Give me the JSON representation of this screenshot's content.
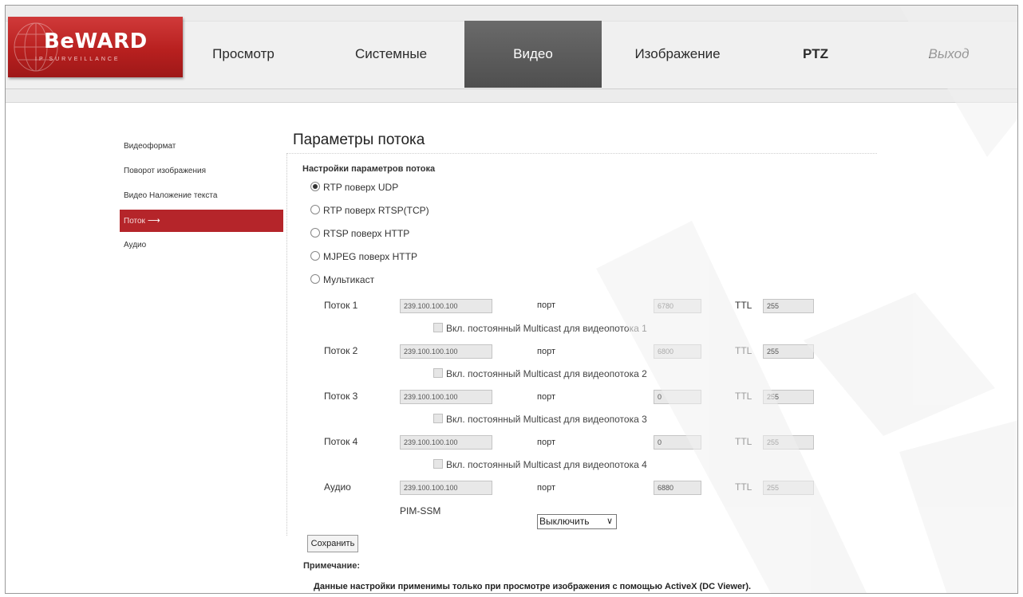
{
  "brand": {
    "logo_text": "BeWARD",
    "tagline": "IP SURVEILLANCE"
  },
  "nav": {
    "tabs": [
      {
        "label": "Просмотр"
      },
      {
        "label": "Системные"
      },
      {
        "label": "Видео",
        "active": true
      },
      {
        "label": "Изображение"
      },
      {
        "label": "PTZ"
      },
      {
        "label": "Выход"
      }
    ]
  },
  "sidebar": {
    "items": [
      {
        "label": "Видеоформат"
      },
      {
        "label": "Поворот изображения"
      },
      {
        "label": "Видео Наложение текста"
      },
      {
        "label": "Поток",
        "active": true,
        "arrow": "⟶"
      },
      {
        "label": "Аудио"
      }
    ]
  },
  "main": {
    "title": "Параметры потока",
    "subtitle": "Настройки параметров потока",
    "protocols": [
      {
        "label": "RTP поверх UDP",
        "checked": true
      },
      {
        "label": "RTP поверх RTSP(TCP)",
        "checked": false
      },
      {
        "label": "RTSP поверх HTTP",
        "checked": false
      },
      {
        "label": "MJPEG поверх HTTP",
        "checked": false
      },
      {
        "label": "Мультикаст",
        "checked": false
      }
    ],
    "port_label": "порт",
    "ttl_label": "TTL",
    "streams": [
      {
        "label": "Поток 1",
        "address": "239.100.100.100",
        "port": "6780",
        "ttl": "255",
        "multicast_label": "Вкл. постоянный Multicast для видеопотока 1"
      },
      {
        "label": "Поток 2",
        "address": "239.100.100.100",
        "port": "6800",
        "ttl": "255",
        "multicast_label": "Вкл. постоянный Multicast для видеопотока 2"
      },
      {
        "label": "Поток 3",
        "address": "239.100.100.100",
        "port": "0",
        "ttl": "255",
        "multicast_label": "Вкл. постоянный Multicast для видеопотока 3"
      },
      {
        "label": "Поток 4",
        "address": "239.100.100.100",
        "port": "0",
        "ttl": "255",
        "multicast_label": "Вкл. постоянный Multicast для видеопотока 4"
      }
    ],
    "audio": {
      "label": "Аудио",
      "address": "239.100.100.100",
      "port": "6880",
      "ttl": "255"
    },
    "pim_ssm": {
      "label": "PIM-SSM",
      "value": "Выключить"
    },
    "save_label": "Сохранить",
    "note_heading": "Примечание:",
    "note_text": "Данные настройки применимы только при просмотре изображения с помощью ActiveX (DC Viewer)."
  },
  "colors": {
    "accent": "#b5252a",
    "active_tab": "#555555"
  }
}
